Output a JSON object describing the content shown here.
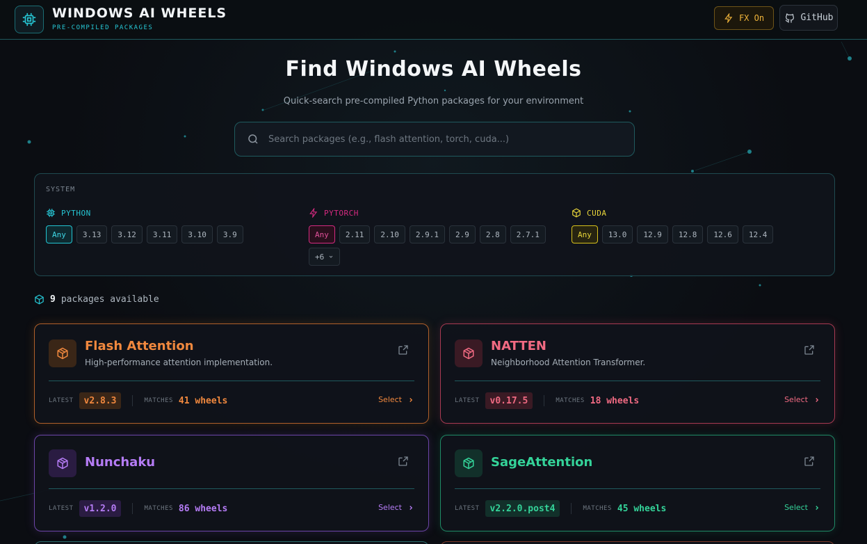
{
  "header": {
    "title": "WINDOWS AI WHEELS",
    "subtitle": "PRE-COMPILED PACKAGES",
    "fx_label": "FX On",
    "github_label": "GitHub"
  },
  "hero": {
    "title": "Find Windows AI Wheels",
    "subtitle": "Quick-search pre-compiled Python packages for your environment"
  },
  "search": {
    "placeholder": "Search packages (e.g., flash attention, torch, cuda...)",
    "value": ""
  },
  "system": {
    "label": "SYSTEM",
    "python": {
      "label": "PYTHON",
      "options": [
        "Any",
        "3.13",
        "3.12",
        "3.11",
        "3.10",
        "3.9"
      ],
      "selected": "Any"
    },
    "pytorch": {
      "label": "PYTORCH",
      "options": [
        "Any",
        "2.11",
        "2.10",
        "2.9.1",
        "2.9",
        "2.8",
        "2.7.1"
      ],
      "more_label": "+6",
      "selected": "Any"
    },
    "cuda": {
      "label": "CUDA",
      "options": [
        "Any",
        "13.0",
        "12.9",
        "12.8",
        "12.6",
        "12.4"
      ],
      "selected": "Any"
    }
  },
  "results": {
    "count": "9",
    "label": "packages available"
  },
  "labels": {
    "latest": "LATEST",
    "matches": "MATCHES",
    "select": "Select"
  },
  "packages": [
    {
      "name": "Flash Attention",
      "description": "High-performance attention implementation.",
      "latest": "v2.8.3",
      "matches": "41 wheels",
      "color": "#f0883e"
    },
    {
      "name": "NATTEN",
      "description": "Neighborhood Attention Transformer.",
      "latest": "v0.17.5",
      "matches": "18 wheels",
      "color": "#f06a82"
    },
    {
      "name": "Nunchaku",
      "description": "",
      "latest": "v1.2.0",
      "matches": "86 wheels",
      "color": "#b57cf5"
    },
    {
      "name": "SageAttention",
      "description": "",
      "latest": "v2.2.0.post4",
      "matches": "45 wheels",
      "color": "#34d399"
    }
  ]
}
